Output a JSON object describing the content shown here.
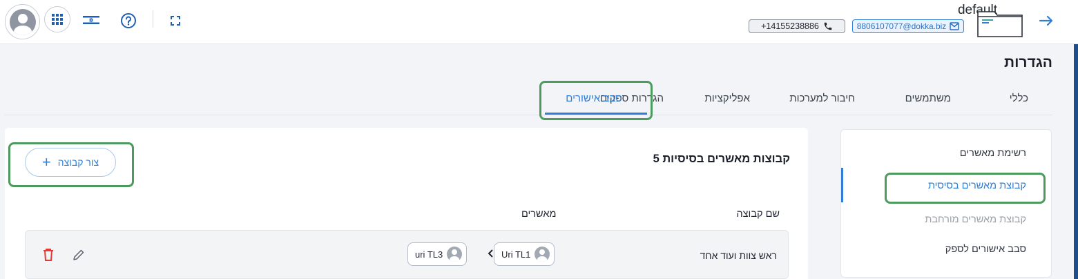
{
  "header": {
    "account_name": "default",
    "phone": "+14155238886",
    "email": "8806107077@dokka.biz"
  },
  "page": {
    "title": "הגדרות"
  },
  "tabs": [
    {
      "label": "כללי"
    },
    {
      "label": "משתמשים"
    },
    {
      "label": "חיבור למערכות"
    },
    {
      "label": "אפליקציות"
    },
    {
      "label": "הגדרות ספקים"
    },
    {
      "label": "סבב אישורים",
      "active": true
    }
  ],
  "sidebar": {
    "items": [
      {
        "label": "רשימת מאשרים"
      },
      {
        "label": "קבוצת מאשרים בסיסית",
        "active": true
      },
      {
        "label": "קבוצת מאשרים מורחבת",
        "disabled": true
      },
      {
        "label": "סבב אישורים לספק"
      }
    ]
  },
  "main": {
    "section_title": "5 קבוצות מאשרים בסיסיות",
    "create_button": "צור קבוצה",
    "columns": {
      "group_name": "שם קבוצה",
      "approvers": "מאשרים"
    },
    "rows": [
      {
        "group_name": "ראש צוות ועוד אחד",
        "approvers": [
          "Uri TL1",
          "uri TL3"
        ]
      }
    ]
  },
  "icons": {
    "avatar": "user-avatar-icon",
    "apps": "apps-grid-icon",
    "language": "israel-flag-icon",
    "help": "help-icon",
    "fullscreen": "fullscreen-icon",
    "phone": "phone-icon",
    "email": "email-icon",
    "folder": "folder-icon",
    "exit": "arrow-right-icon",
    "edit": "pencil-icon",
    "delete": "trash-icon"
  },
  "colors": {
    "accent": "#2f7fd9",
    "highlight": "#4d9a5e",
    "delete": "#e53935"
  }
}
